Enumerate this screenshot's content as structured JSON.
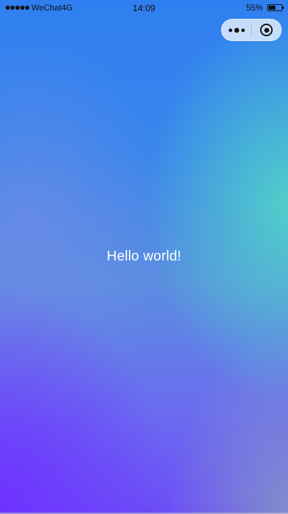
{
  "status_bar": {
    "carrier": "WeChat4G",
    "time": "14:09",
    "battery_percent_text": "55%",
    "battery_level": 0.55,
    "signal_icon": "signal-dots-icon",
    "battery_icon": "battery-icon"
  },
  "capsule": {
    "more_icon": "more-dots-icon",
    "close_icon": "target-circle-icon"
  },
  "main": {
    "text": "Hello world!"
  },
  "colors": {
    "background_top": "#2f7ff0",
    "background_bottom_left": "#6e32ff",
    "background_right": "#50d2c8",
    "text": "#ffffff"
  }
}
